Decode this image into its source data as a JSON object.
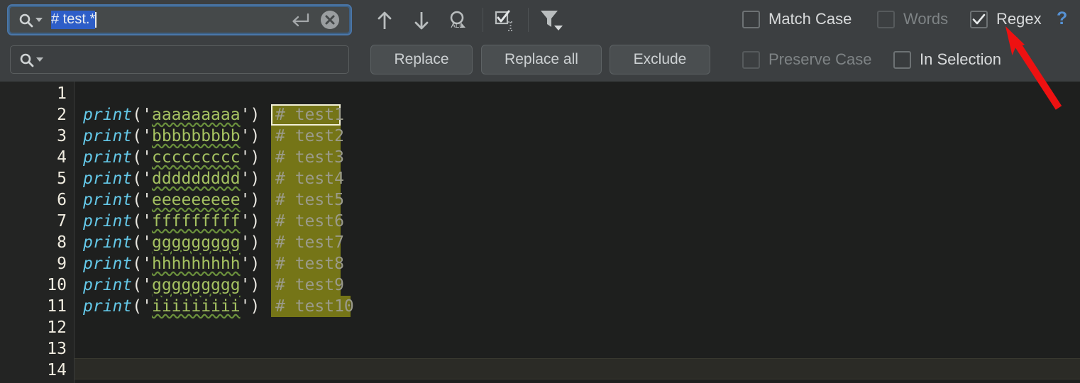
{
  "search": {
    "value": "# test.*",
    "placeholder": "",
    "magnifier_icon": "search-icon",
    "dropdown_icon": "chevron-down-icon",
    "enter_icon": "return-arrow-icon",
    "clear_icon": "clear-circle-x-icon"
  },
  "replace": {
    "value": "",
    "placeholder": "",
    "magnifier_icon": "search-icon",
    "dropdown_icon": "chevron-down-icon"
  },
  "toolbar": {
    "prev_icon": "arrow-up-icon",
    "next_icon": "arrow-down-icon",
    "find_all_icon": "find-all-occurrences-icon",
    "find_all_label": "ALL",
    "select_all_icon": "select-all-occurrences-icon",
    "filter_icon": "filter-funnel-icon"
  },
  "actions": {
    "replace": "Replace",
    "replace_all": "Replace all",
    "exclude": "Exclude"
  },
  "options": {
    "match_case": {
      "label": "Match Case",
      "checked": false,
      "enabled": true
    },
    "words": {
      "label": "Words",
      "checked": false,
      "enabled": false
    },
    "regex": {
      "label": "Regex",
      "checked": true,
      "enabled": true
    },
    "help": {
      "label": "?"
    },
    "preserve_case": {
      "label": "Preserve Case",
      "checked": false,
      "enabled": false
    },
    "in_selection": {
      "label": "In Selection",
      "checked": false,
      "enabled": true
    }
  },
  "editor": {
    "line_numbers": [
      "1",
      "2",
      "3",
      "4",
      "5",
      "6",
      "7",
      "8",
      "9",
      "10",
      "11",
      "12",
      "13",
      "14"
    ],
    "caret_line": 14,
    "lines": [
      {
        "num": 1,
        "code": "",
        "string": "",
        "comment": ""
      },
      {
        "num": 2,
        "code": "print",
        "string": "aaaaaaaaa",
        "comment": "# test1"
      },
      {
        "num": 3,
        "code": "print",
        "string": "bbbbbbbbb",
        "comment": "# test2"
      },
      {
        "num": 4,
        "code": "print",
        "string": "ccccccccc",
        "comment": "# test3"
      },
      {
        "num": 5,
        "code": "print",
        "string": "ddddddddd",
        "comment": "# test4"
      },
      {
        "num": 6,
        "code": "print",
        "string": "eeeeeeeee",
        "comment": "# test5"
      },
      {
        "num": 7,
        "code": "print",
        "string": "fffffffff",
        "comment": "# test6"
      },
      {
        "num": 8,
        "code": "print",
        "string": "ggggggggg",
        "comment": "# test7"
      },
      {
        "num": 9,
        "code": "print",
        "string": "hhhhhhhhh",
        "comment": "# test8"
      },
      {
        "num": 10,
        "code": "print",
        "string": "ggggggggg",
        "comment": "# test9"
      },
      {
        "num": 11,
        "code": "print",
        "string": "iiiiiiiii",
        "comment": "# test10"
      },
      {
        "num": 12,
        "code": "",
        "string": "",
        "comment": ""
      },
      {
        "num": 13,
        "code": "",
        "string": "",
        "comment": ""
      },
      {
        "num": 14,
        "code": "",
        "string": "",
        "comment": ""
      }
    ]
  },
  "annotation": {
    "arrow_color": "#ee1111",
    "points_to": "regex-checkbox"
  },
  "colors": {
    "panel_bg": "#3c3f41",
    "editor_bg": "#1e1f1e",
    "match_highlight": "#757517",
    "current_match_border": "#f2f0d8",
    "selection_blue": "#2e5ec8",
    "keyword": "#64c8e8",
    "string": "#a5c261",
    "comment": "#9b9b8a",
    "accent_link": "#5691d3"
  }
}
